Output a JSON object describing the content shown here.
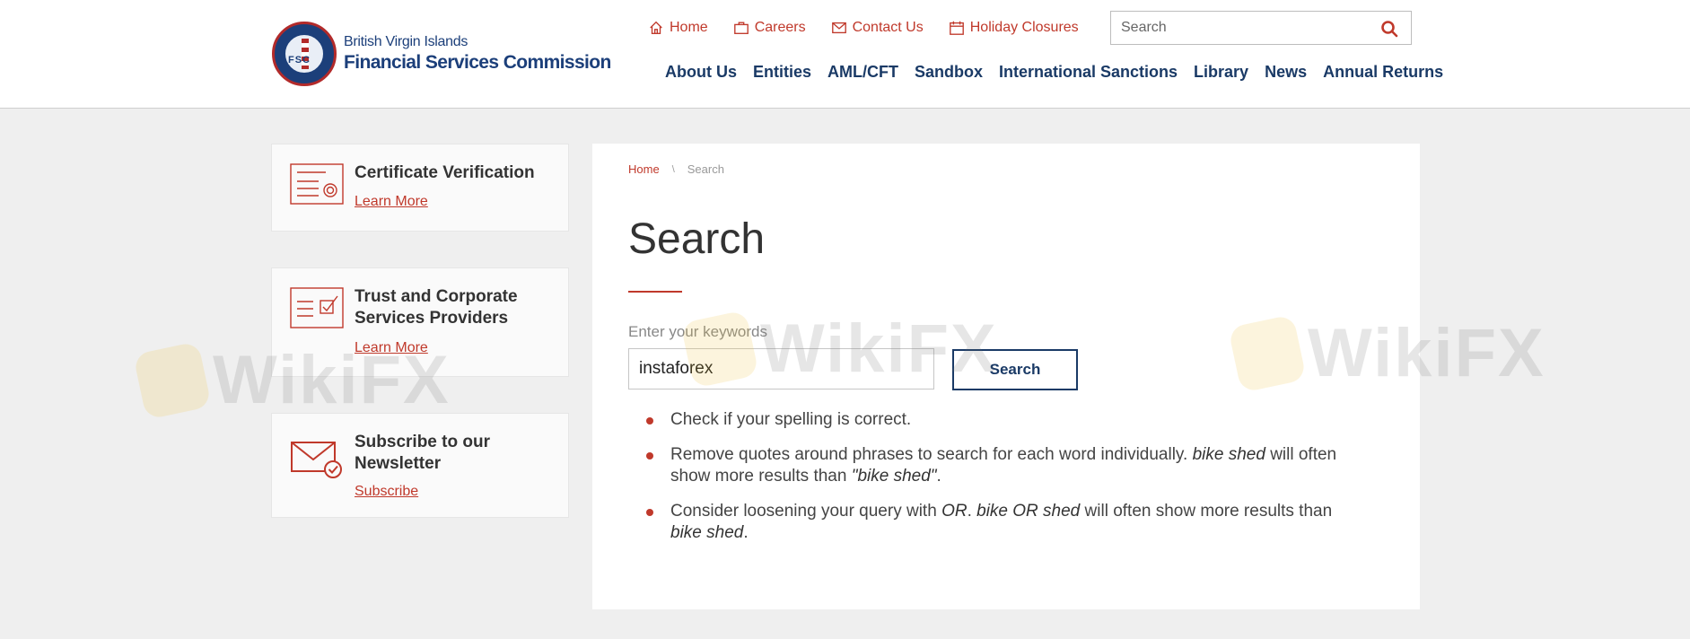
{
  "logo": {
    "line1": "British Virgin Islands",
    "line2": "Financial Services Commission",
    "seal_text": "FSC"
  },
  "utility_nav": [
    {
      "label": "Home",
      "icon": "home-icon"
    },
    {
      "label": "Careers",
      "icon": "briefcase-icon"
    },
    {
      "label": "Contact Us",
      "icon": "envelope-icon"
    },
    {
      "label": "Holiday Closures",
      "icon": "calendar-icon"
    }
  ],
  "header_search": {
    "placeholder": "Search",
    "icon": "search-icon"
  },
  "main_nav": [
    "About Us",
    "Entities",
    "AML/CFT",
    "Sandbox",
    "International Sanctions",
    "Library",
    "News",
    "Annual Returns"
  ],
  "sidebar": [
    {
      "title": "Certificate Verification",
      "link": "Learn More",
      "icon": "certificate-icon"
    },
    {
      "title": "Trust and Corporate Services Providers",
      "link": "Learn More",
      "icon": "checklist-icon"
    },
    {
      "title": "Subscribe to our Newsletter",
      "link": "Subscribe",
      "icon": "envelope-check-icon"
    }
  ],
  "breadcrumb": {
    "home": "Home",
    "separator": "\\",
    "current": "Search"
  },
  "page_title": "Search",
  "search_form": {
    "label": "Enter your keywords",
    "value": "instaforex",
    "button": "Search"
  },
  "tips": [
    {
      "t1": "Check if your spelling is correct."
    },
    {
      "t1": "Remove quotes around phrases to search for each word individually. ",
      "e1": "bike shed",
      "t2": " will often show more results than ",
      "e2": "\"bike shed\"",
      "t3": "."
    },
    {
      "t1": "Consider loosening your query with ",
      "e1": "OR",
      "t2": ". ",
      "e2": "bike OR shed",
      "t3": " will often show more results than ",
      "e3": "bike shed",
      "t4": "."
    }
  ],
  "watermark": "WikiFX",
  "colors": {
    "accent": "#c0392b",
    "navy": "#1a3a66",
    "background": "#efefef"
  }
}
